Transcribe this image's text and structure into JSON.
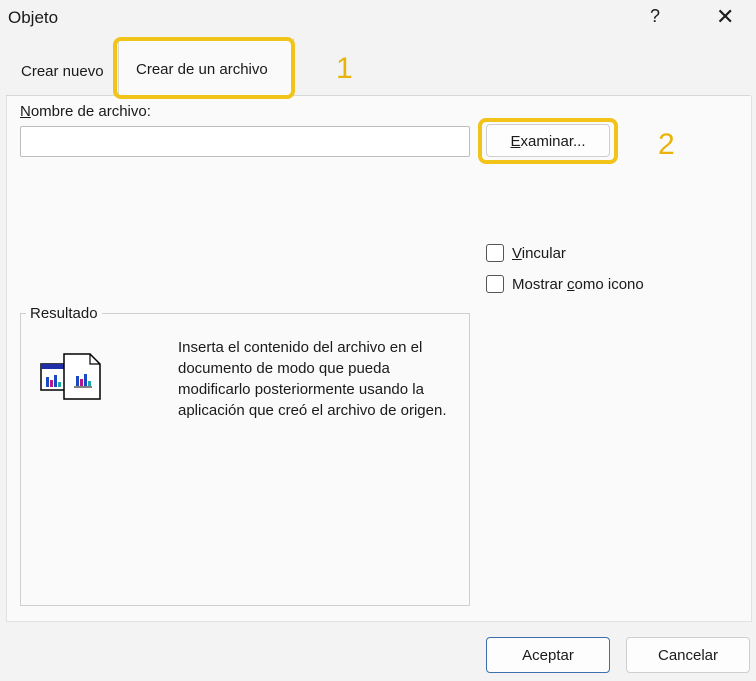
{
  "window": {
    "title": "Objeto",
    "help": "?",
    "close": "✕"
  },
  "tabs": [
    {
      "label": "Crear nuevo",
      "active": false
    },
    {
      "label": "Crear de un archivo",
      "active": true
    }
  ],
  "annotations": {
    "n1": "1",
    "n2": "2",
    "color": "#f2c318"
  },
  "file": {
    "label_prefix_u": "N",
    "label_rest": "ombre de archivo:",
    "value": "",
    "browse_u": "E",
    "browse_rest": "xaminar..."
  },
  "options": {
    "link_u": "V",
    "link_rest": "incular",
    "link_checked": false,
    "icon_pre": "Mostrar ",
    "icon_u": "c",
    "icon_rest": "omo icono",
    "icon_checked": false
  },
  "result": {
    "legend": "Resultado",
    "text": "Inserta el contenido del archivo en el documento de modo que pueda modificarlo posteriormente usando la aplicación que creó el archivo de origen."
  },
  "buttons": {
    "ok": "Aceptar",
    "cancel": "Cancelar"
  }
}
